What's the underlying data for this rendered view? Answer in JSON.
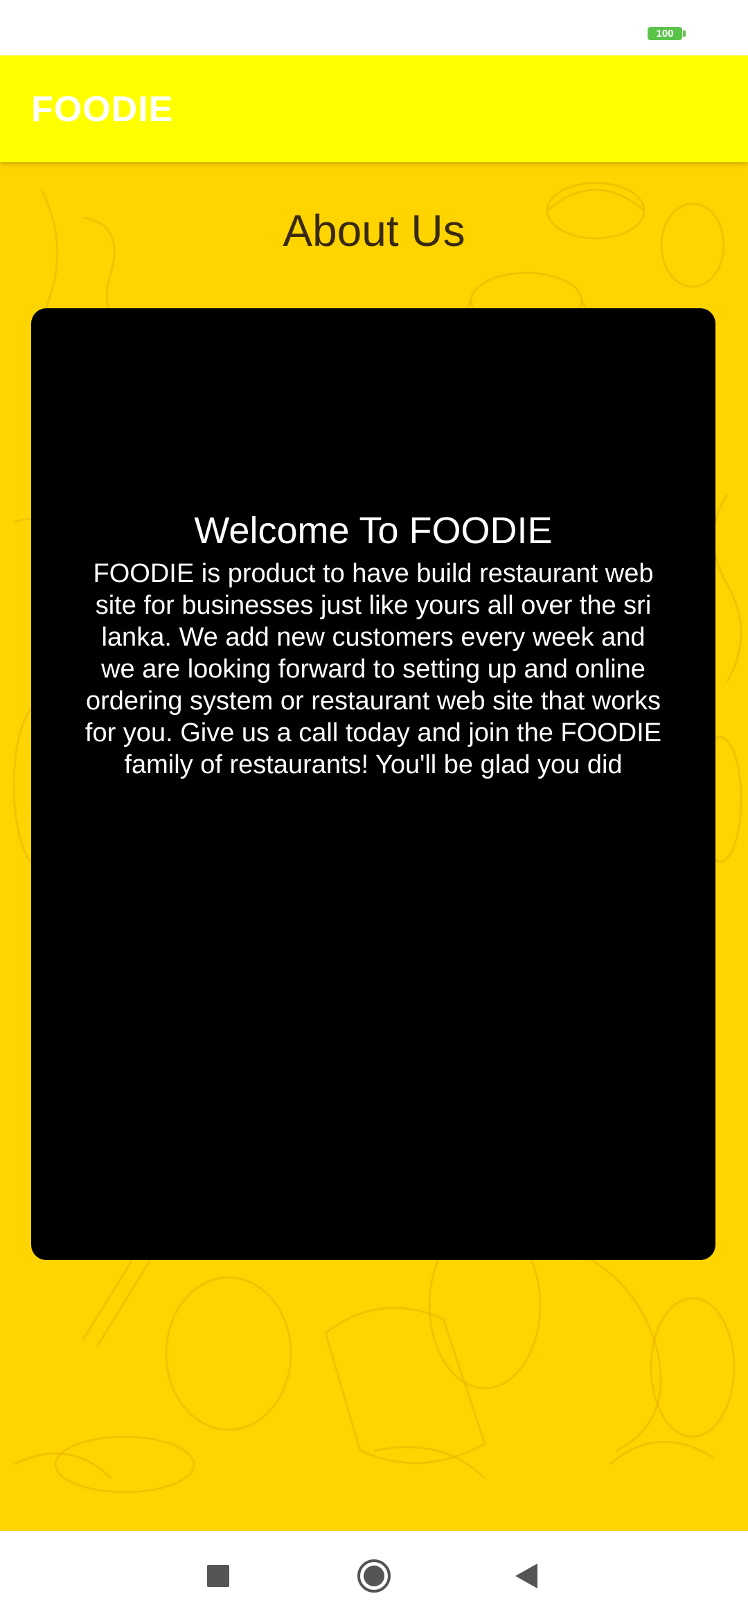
{
  "status_bar": {
    "battery_level": "100",
    "battery_color": "#5cc34a"
  },
  "app_bar": {
    "title": "FOODIE",
    "color": "#ffff00"
  },
  "page": {
    "title": "About Us",
    "background_color": "#ffd400"
  },
  "card": {
    "heading": "Welcome To FOODIE",
    "body": "FOODIE is product to have build restaurant web site for businesses just like yours all over the sri lanka. We add new customers every week and we are looking forward to setting up and online ordering system or restaurant web site that works for you. Give us a call today and join the FOODIE family of restaurants! You'll be glad you did"
  },
  "nav_bar": {
    "buttons": [
      {
        "icon": "square-recents-icon"
      },
      {
        "icon": "circle-home-icon"
      },
      {
        "icon": "triangle-back-icon"
      }
    ]
  }
}
